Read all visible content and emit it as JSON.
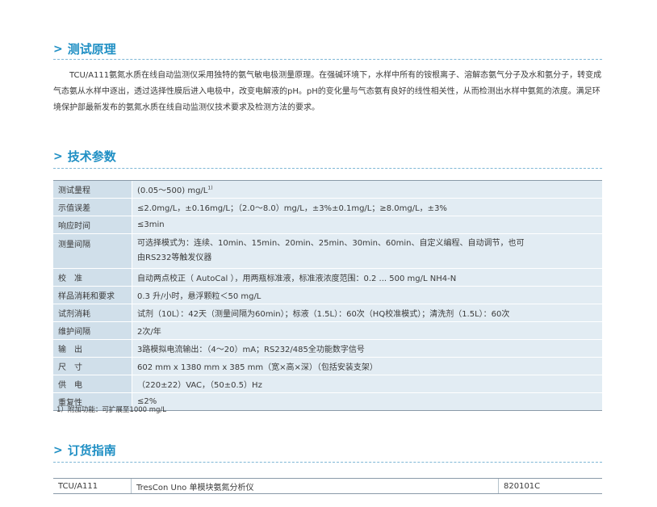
{
  "principle": {
    "title": "测试原理",
    "text": "TCU/A111氨氮水质在线自动监测仪采用独特的氨气敏电极测量原理。在强碱环境下，水样中所有的铵根离子、溶解态氨气分子及水和氨分子，转变成气态氨从水样中逐出，透过选择性膜后进入电极中，改变电解液的pH。pH的变化量与气态氨有良好的线性相关性，从而检测出水样中氨氮的浓度。满足环境保护部最新发布的氨氮水质在线自动监测仪技术要求及检测方法的要求。"
  },
  "specs": {
    "title": "技术参数",
    "rows": [
      {
        "label": "测试量程",
        "value": "(0.05～500) mg/L",
        "sup": "1)"
      },
      {
        "label": "示值误差",
        "value": "≤2.0mg/L，±0.16mg/L；（2.0～8.0）mg/L，±3%±0.1mg/L；≥8.0mg/L，±3%"
      },
      {
        "label": "响应时间",
        "value": "≤3min"
      },
      {
        "label": "测量间隔",
        "value": "可选择模式为：连续、10min、15min、20min、25min、30min、60min、自定义编程、自动调节，也可",
        "value2": "由RS232等触发仪器"
      },
      {
        "label": "校　准",
        "value": "自动两点校正（ AutoCal ），用两瓶标准液，标准液浓度范围：0.2 ... 500 mg/L NH4-N"
      },
      {
        "label": "样品消耗和要求",
        "value": "0.3 升/小时，悬浮颗粒＜50 mg/L"
      },
      {
        "label": "试剂消耗",
        "value": "试剂（10L）：42天（测量间隔为60min）；标液（1.5L）：60次（HQ校准模式）；清洗剂（1.5L）：60次"
      },
      {
        "label": "维护间隔",
        "value": "2次/年"
      },
      {
        "label": "输　出",
        "value": "3路模拟电流输出：（4～20）mA；RS232/485全功能数字信号"
      },
      {
        "label": "尺　寸",
        "value": "602 mm x 1380 mm x 385 mm（宽×高×深）（包括安装支架）"
      },
      {
        "label": "供　电",
        "value": "（220±22）VAC，（50±0.5）Hz"
      },
      {
        "label": "重复性",
        "value": "≤2%"
      }
    ],
    "note": "1）附加功能：可扩展至1000 mg/L"
  },
  "order": {
    "title": "订货指南",
    "rows": [
      {
        "model": "TCU/A111",
        "name": "TresCon Uno 单模块氨氮分析仪",
        "code": "820101C"
      }
    ]
  }
}
